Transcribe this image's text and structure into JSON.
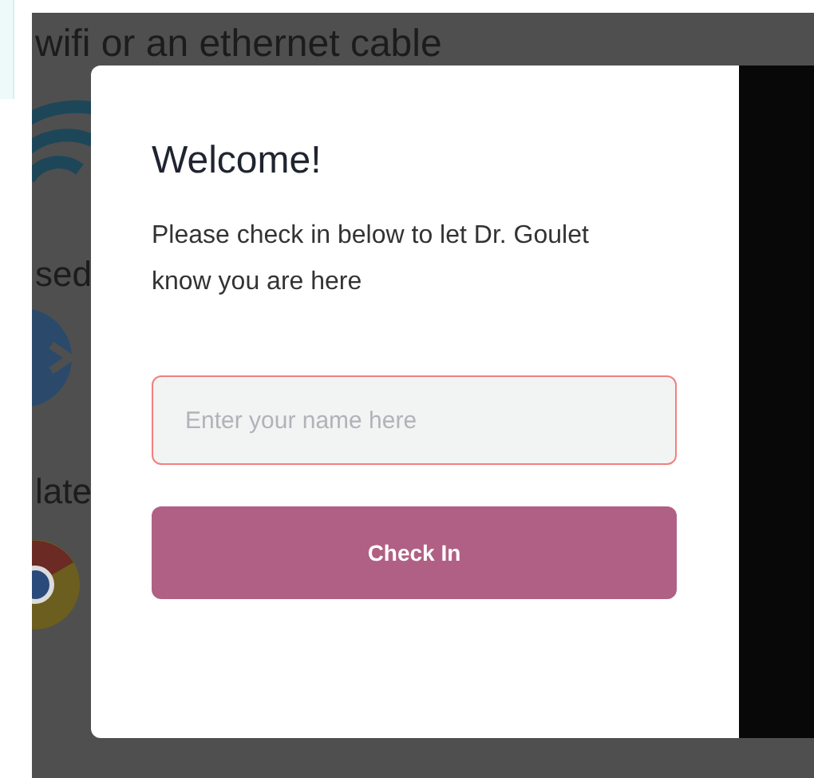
{
  "background": {
    "texts": [
      {
        "text": "wifi or an ethernet cable",
        "kind": "heading"
      },
      {
        "text": "sed",
        "kind": "label"
      },
      {
        "text": "late",
        "kind": "label"
      }
    ]
  },
  "modal": {
    "title": "Welcome!",
    "message": "Please check in below to let Dr. Goulet know you are here",
    "name_field": {
      "placeholder": "Enter your name here",
      "invalid": true
    },
    "button": "Check In"
  }
}
